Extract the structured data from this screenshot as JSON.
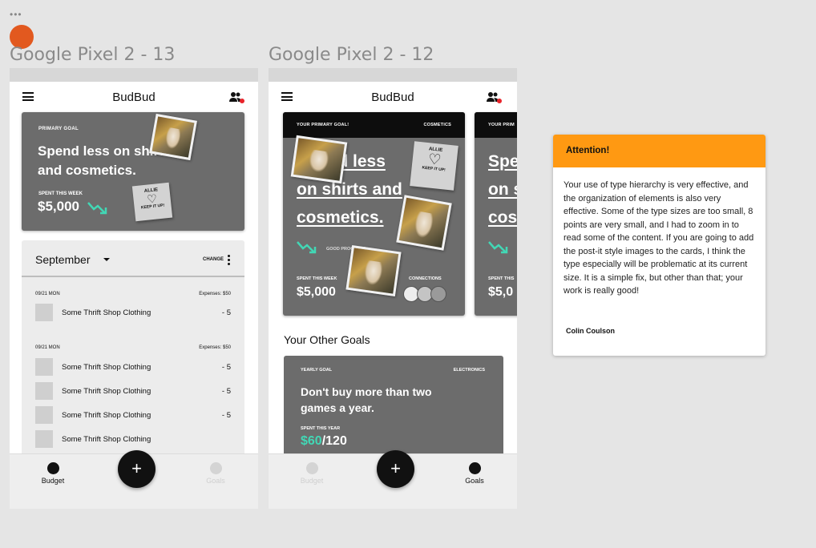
{
  "canvas": {
    "menu_dots": "•••"
  },
  "frames": [
    {
      "title": "Google Pixel 2 - 13",
      "app_title": "BudBud",
      "goal_card": {
        "kicker": "PRIMARY GOAL",
        "headline": "Spend less on shirts and cosmetics.",
        "spent_label": "SPENT THIS WEEK",
        "spent_value": "$5,000",
        "postit": {
          "name": "ALLIE",
          "heart": "♡",
          "note": "KEEP IT UP!"
        }
      },
      "month_panel": {
        "month": "September",
        "change_label": "CHANGE",
        "groups": [
          {
            "date": "09/21 MON",
            "expenses": "Expenses: $50",
            "items": [
              {
                "label": "Some Thrift Shop Clothing",
                "amount": "- 5"
              }
            ]
          },
          {
            "date": "09/21 MON",
            "expenses": "Expenses: $50",
            "items": [
              {
                "label": "Some Thrift Shop Clothing",
                "amount": "- 5"
              },
              {
                "label": "Some Thrift Shop Clothing",
                "amount": "- 5"
              },
              {
                "label": "Some Thrift Shop Clothing",
                "amount": "- 5"
              },
              {
                "label": "Some Thrift Shop Clothing",
                "amount": ""
              }
            ]
          }
        ]
      },
      "nav": {
        "left": "Budget",
        "fab": "+",
        "right": "Goals",
        "active": "left"
      }
    },
    {
      "title": "Google Pixel 2 - 12",
      "app_title": "BudBud",
      "primary_card": {
        "band_left": "YOUR PRIMARY GOAL!",
        "band_right": "COSMETICS",
        "headline_lines": [
          "Spend less",
          "on shirts and",
          "cosmetics."
        ],
        "progress_label": "GOOD PROGRESS",
        "spent_label": "SPENT THIS WEEK",
        "spent_value": "$5,000",
        "connections_label": "CONNECTIONS",
        "postit": {
          "name": "ALLIE",
          "heart": "♡",
          "note": "KEEP IT UP!"
        }
      },
      "peek_card": {
        "band_left": "YOUR PRIM",
        "headline_lines": [
          "Spe",
          "on s",
          "cos"
        ],
        "spent_label": "SPENT THIS",
        "spent_value": "$5,0"
      },
      "other_goals_title": "Your Other Goals",
      "yearly_card": {
        "kicker": "YEARLY GOAL",
        "category": "ELECTRONICS",
        "headline": "Don't buy more than two games a year.",
        "spent_label": "SPENT THIS YEAR",
        "spent_current": "$60",
        "spent_total": "/120"
      },
      "nav": {
        "left": "Budget",
        "fab": "+",
        "right": "Goals",
        "active": "right"
      }
    }
  ],
  "comment": {
    "title": "Attention!",
    "body": "Your use of type hierarchy is very effective, and the organization of elements is also very effective. Some of the type sizes are too small, 8 points are very small, and I had to zoom in to read some of the content. If you are going to add the post-it style images to the cards, I think the type especially will be problematic at its current size. It is a simple fix, but other than that; your work is really good!",
    "author": "Colin Coulson"
  },
  "colors": {
    "accent_teal": "#42d7b5",
    "alert_orange": "#ff9912",
    "avatar_orange": "#e2591f",
    "card_gray": "#6c6c6c"
  }
}
